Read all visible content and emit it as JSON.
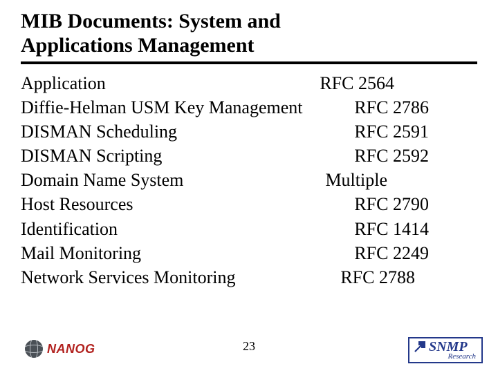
{
  "title_line1": "MIB Documents: System and",
  "title_line2": "Applications Management",
  "rows": [
    {
      "name": "Application",
      "rfc": "RFC 2564"
    },
    {
      "name": "Diffie-Helman USM Key Management",
      "rfc": "RFC 2786"
    },
    {
      "name": "DISMAN Scheduling",
      "rfc": "RFC 2591"
    },
    {
      "name": "DISMAN Scripting",
      "rfc": "RFC 2592"
    },
    {
      "name": "Domain Name System",
      "rfc": "Multiple"
    },
    {
      "name": "Host Resources",
      "rfc": "RFC 2790"
    },
    {
      "name": "Identification",
      "rfc": "RFC 1414"
    },
    {
      "name": "Mail Monitoring",
      "rfc": "RFC 2249"
    },
    {
      "name": "Network Services Monitoring",
      "rfc": "RFC 2788"
    }
  ],
  "page_number": "23",
  "logo_left_text": "NANOG",
  "logo_right_main": "SNMP",
  "logo_right_sub": "Research"
}
